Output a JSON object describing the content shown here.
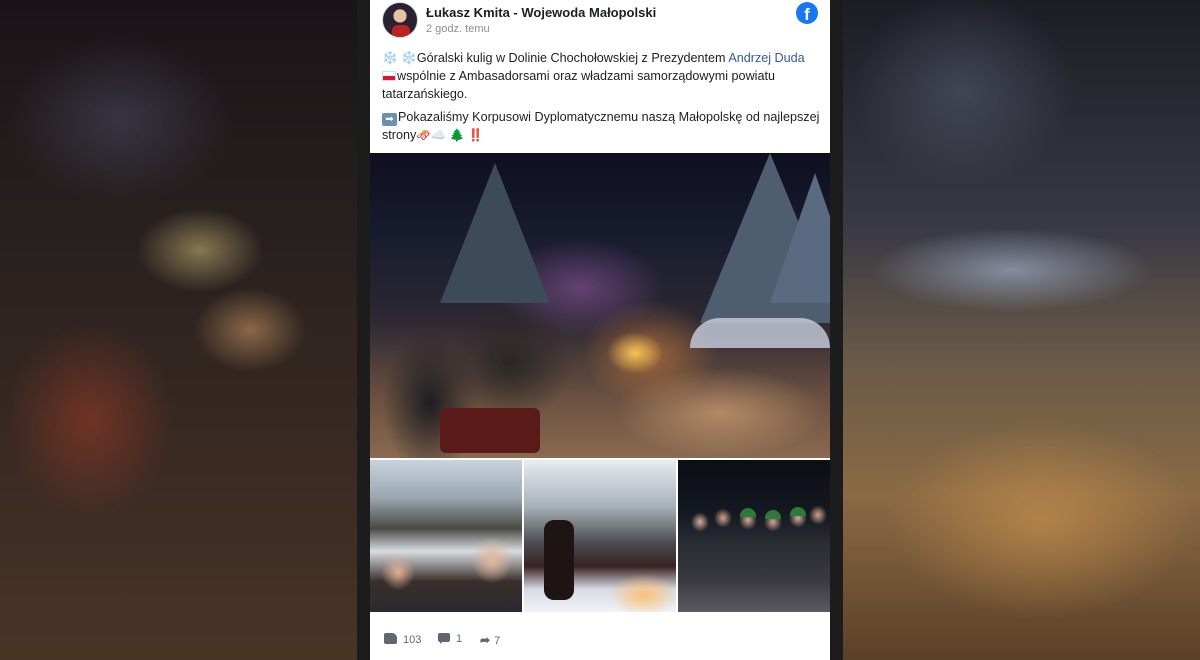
{
  "post": {
    "author": "Łukasz Kmita - Wojewoda Małopolski",
    "time": "2 godz. temu",
    "platform_icon": "facebook-icon",
    "text_p1_pre": "Góralski kulig w Dolinie Chochołowskiej z Prezydentem ",
    "mention": "Andrzej Duda",
    "text_p1_post": "wspólnie z Ambasadorsami oraz władzami samorządowymi powiatu tatarzańskiego.",
    "text_p2": "Pokazaliśmy Korpusowi Dyplomatycznemu naszą Małopolskę od najlepszej strony",
    "emoji_snow": "❄️",
    "emoji_tree": "🌲",
    "emoji_bang": "‼️",
    "emoji_cloud": "☁️",
    "emoji_sled": "🛷"
  },
  "stats": {
    "likes": "103",
    "comments": "1",
    "shares": "7"
  },
  "colors": {
    "facebook_blue": "#1877f2",
    "mention": "#385898",
    "text": "#1c1e21",
    "muted": "#606770"
  }
}
